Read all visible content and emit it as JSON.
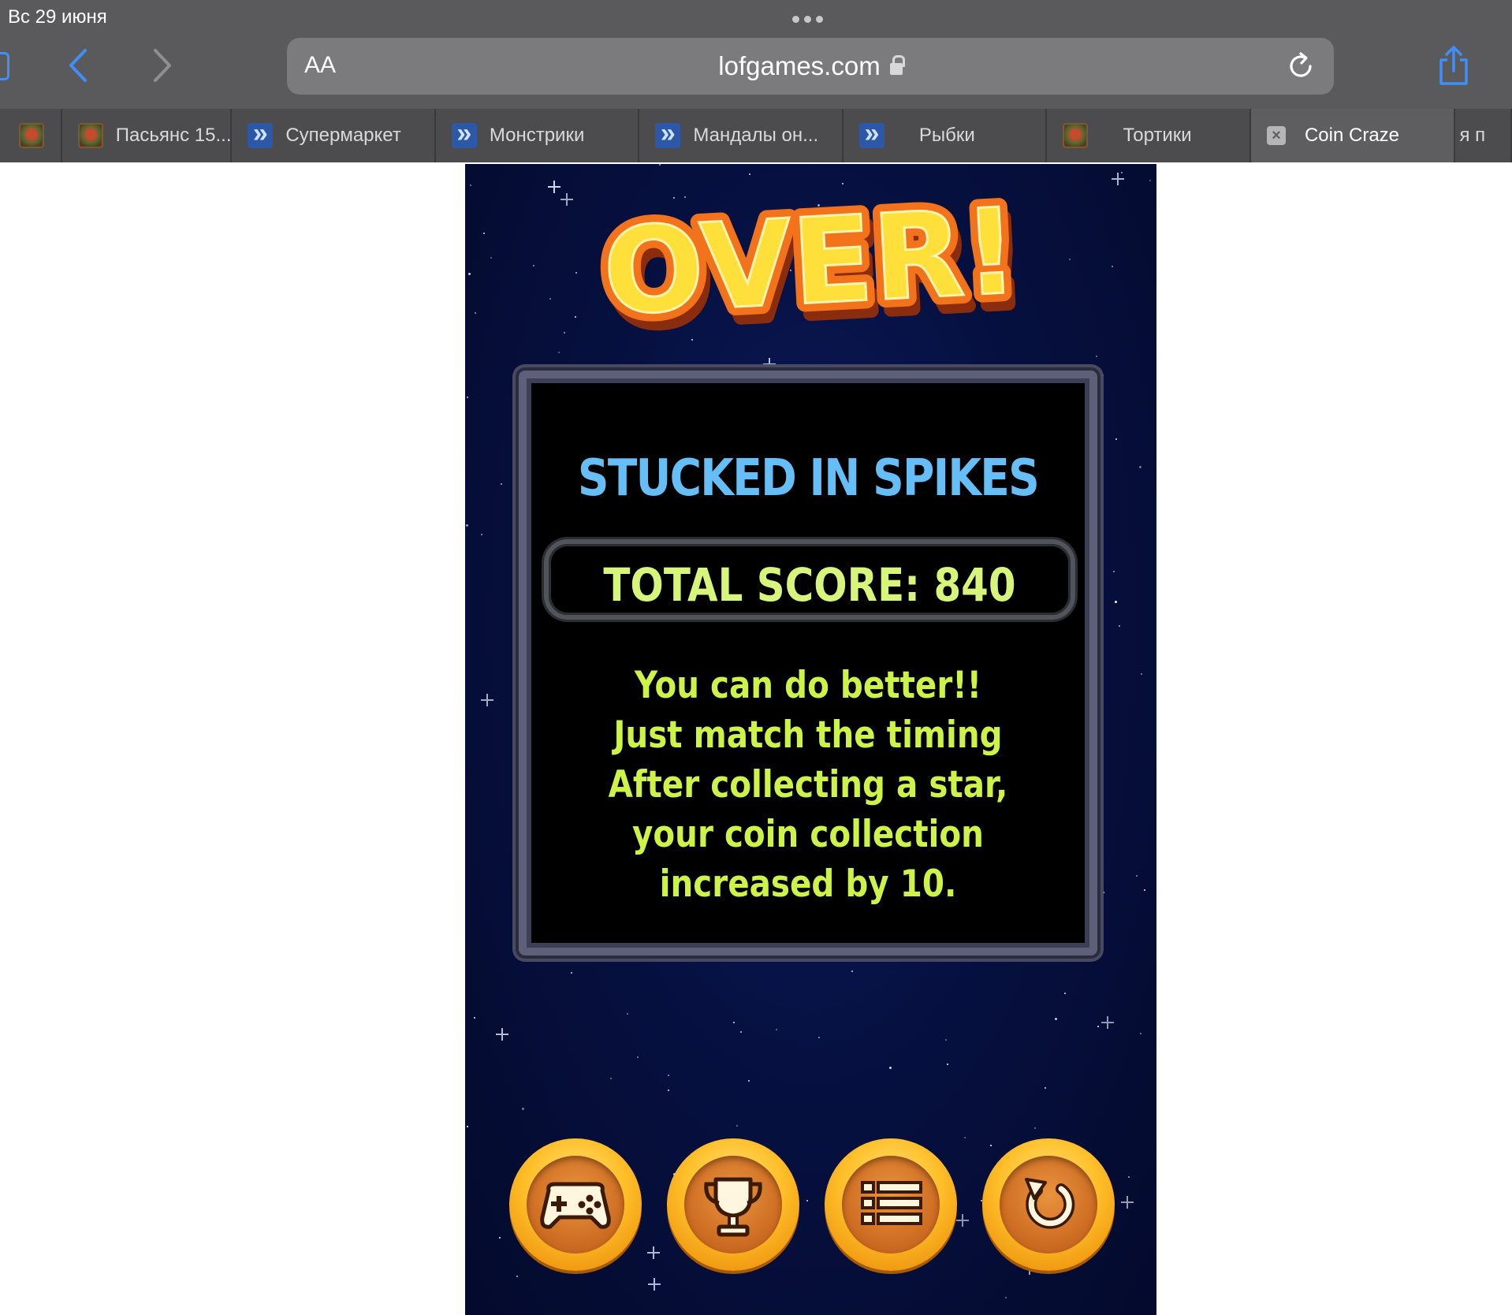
{
  "status_bar": {
    "date": "Вс 29 июня"
  },
  "address_bar": {
    "text_size_label": "AA",
    "url": "lofgames.com"
  },
  "tabs": [
    {
      "label": "",
      "favicon": "game-thumbnail-icon"
    },
    {
      "label": "Пасьянс 15...",
      "favicon": "game-thumbnail-icon"
    },
    {
      "label": "Супермаркет",
      "favicon": "blue-arrows-icon"
    },
    {
      "label": "Монстрики",
      "favicon": "blue-arrows-icon"
    },
    {
      "label": "Мандалы он...",
      "favicon": "blue-arrows-icon"
    },
    {
      "label": "Рыбки",
      "favicon": "blue-arrows-icon"
    },
    {
      "label": "Тортики",
      "favicon": "game-thumbnail-icon"
    },
    {
      "label": "Coin Craze",
      "favicon": "close-icon",
      "active": true
    },
    {
      "label": "я п",
      "favicon": ""
    }
  ],
  "game": {
    "title": "OVER!",
    "heading": "STUCKED IN SPIKES",
    "score_label": "TOTAL SCORE: 840",
    "message_lines": [
      "You can do better!!",
      "Just match the timing",
      "After collecting a star,",
      "your coin collection",
      "increased by 10."
    ],
    "buttons": [
      "gamepad-icon",
      "trophy-icon",
      "list-icon",
      "restart-icon"
    ]
  },
  "colors": {
    "chrome_bg": "#5a5a5c",
    "accent_blue": "#3f8ff7",
    "heading_blue": "#66bef7",
    "score_green": "#d7f57b",
    "message_green": "#cdf349",
    "title_yellow": "#ffe03a",
    "title_orange": "#f2731c"
  }
}
